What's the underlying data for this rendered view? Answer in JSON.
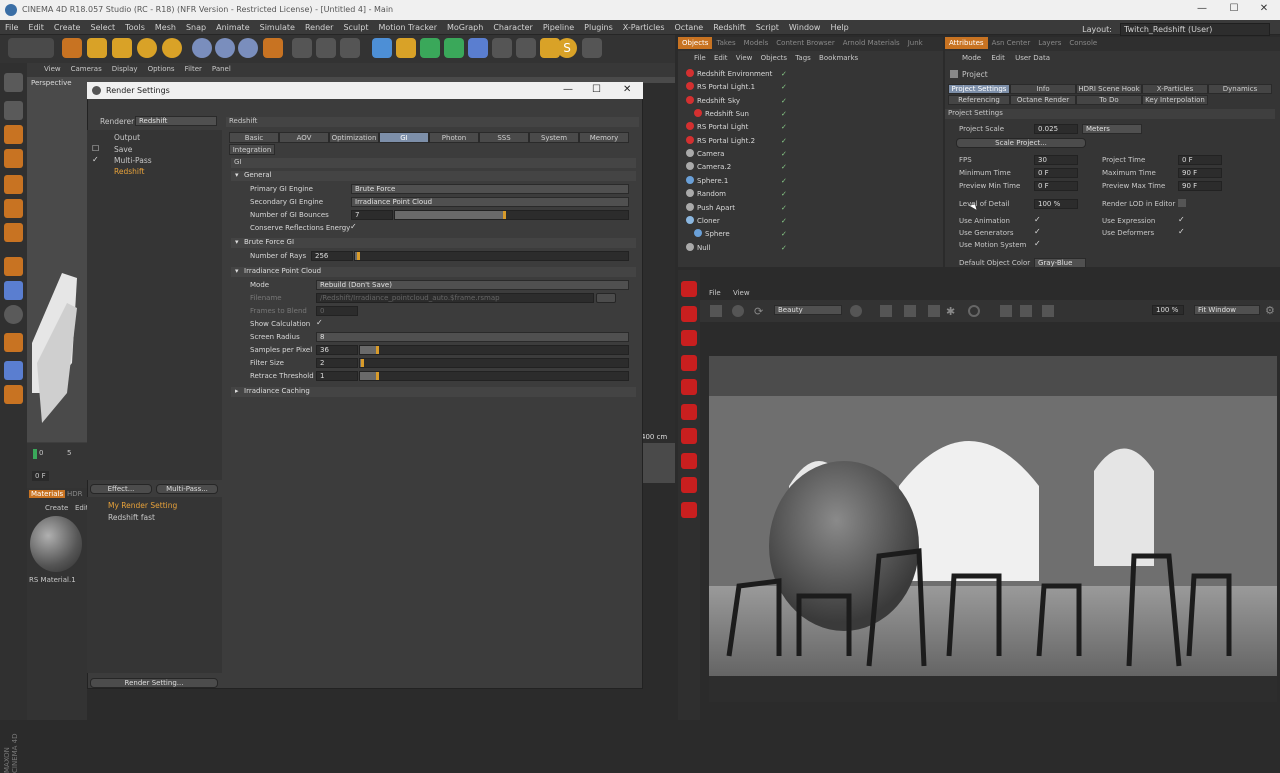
{
  "window": {
    "title": "CINEMA 4D R18.057 Studio (RC - R18) (NFR Version - Restricted License) - [Untitled 4] - Main"
  },
  "menu": [
    "File",
    "Edit",
    "Create",
    "Select",
    "Tools",
    "Mesh",
    "Snap",
    "Animate",
    "Simulate",
    "Render",
    "Sculpt",
    "Motion Tracker",
    "MoGraph",
    "Character",
    "Pipeline",
    "Plugins",
    "X-Particles",
    "Octane",
    "Redshift",
    "Script",
    "Window",
    "Help"
  ],
  "layout": {
    "label": "Layout:",
    "value": "Twitch_Redshift (User)"
  },
  "viewport": {
    "menu": [
      "View",
      "Cameras",
      "Display",
      "Options",
      "Filter",
      "Panel"
    ],
    "label": "Perspective",
    "scale": "400 cm"
  },
  "timeline": {
    "start": "0",
    "end": "5",
    "field": "0 F"
  },
  "materials": {
    "tabs": [
      "Materials",
      "HDR"
    ],
    "menu": [
      "Create",
      "Edit"
    ],
    "item": "RS Material.1"
  },
  "render_settings": {
    "title": "Render Settings",
    "renderer_label": "Renderer",
    "renderer_value": "Redshift",
    "tree": [
      "Output",
      "Save",
      "Multi-Pass",
      "Redshift"
    ],
    "presets": [
      "My Render Setting",
      "Redshift fast"
    ],
    "buttons": {
      "effect": "Effect...",
      "multipass": "Multi-Pass...",
      "render_setting": "Render Setting..."
    },
    "panel_header": "Redshift",
    "tabs": [
      "Basic",
      "AOV",
      "Optimization",
      "GI",
      "Photon",
      "SSS",
      "System",
      "Memory"
    ],
    "tab_integration": "Integration",
    "gi_label": "GI",
    "general": {
      "header": "General",
      "primary_label": "Primary GI Engine",
      "primary_value": "Brute Force",
      "secondary_label": "Secondary GI Engine",
      "secondary_value": "Irradiance Point Cloud",
      "bounces_label": "Number of GI Bounces",
      "bounces_value": "7",
      "conserve_label": "Conserve Reflections Energy"
    },
    "brute": {
      "header": "Brute Force GI",
      "rays_label": "Number of Rays",
      "rays_value": "256"
    },
    "ipc": {
      "header": "Irradiance Point Cloud",
      "mode_label": "Mode",
      "mode_value": "Rebuild (Don't Save)",
      "filename_label": "Filename",
      "filename_value": "/Redshift/Irradiance_pointcloud_auto.$frame.rsmap",
      "frames_label": "Frames to Blend",
      "frames_value": "0",
      "showcalc_label": "Show Calculation",
      "radius_label": "Screen Radius",
      "radius_value": "8",
      "spp_label": "Samples per Pixel",
      "spp_value": "36",
      "filter_label": "Filter Size",
      "filter_value": "2",
      "retrace_label": "Retrace Threshold",
      "retrace_value": "1"
    },
    "caching_header": "Irradiance Caching"
  },
  "objects": {
    "tabs": [
      "Objects",
      "Takes",
      "Models",
      "Content Browser",
      "Arnold Materials",
      "Junk"
    ],
    "menu": [
      "File",
      "Edit",
      "View",
      "Objects",
      "Tags",
      "Bookmarks"
    ],
    "items": [
      {
        "name": "Redshift Environment",
        "color": "#d43030"
      },
      {
        "name": "RS Portal Light.1",
        "color": "#d43030"
      },
      {
        "name": "Redshift Sky",
        "color": "#d43030"
      },
      {
        "name": "Redshift Sun",
        "color": "#d43030"
      },
      {
        "name": "RS Portal Light",
        "color": "#d43030"
      },
      {
        "name": "RS Portal Light.2",
        "color": "#d43030"
      },
      {
        "name": "Camera",
        "color": "#aaaaaa"
      },
      {
        "name": "Camera.2",
        "color": "#aaaaaa"
      },
      {
        "name": "Sphere.1",
        "color": "#6aa0d8"
      },
      {
        "name": "Random",
        "color": "#aaaaaa"
      },
      {
        "name": "Push Apart",
        "color": "#aaaaaa"
      },
      {
        "name": "Cloner",
        "color": "#8bb7e0"
      },
      {
        "name": "Sphere",
        "color": "#6aa0d8"
      },
      {
        "name": "Null",
        "color": "#aaaaaa"
      }
    ]
  },
  "attributes": {
    "tabs": [
      "Attributes",
      "Asn Center",
      "Layers",
      "Console"
    ],
    "menu": [
      "Mode",
      "Edit",
      "User Data"
    ],
    "title": "Project",
    "subtabs": [
      "Project Settings",
      "Info",
      "HDRI Scene Hook",
      "X-Particles",
      "Dynamics",
      "Referencing",
      "Octane Render",
      "To Do",
      "Key Interpolation"
    ],
    "section": "Project Settings",
    "scale_label": "Project Scale",
    "scale_value": "0.025",
    "scale_unit": "Meters",
    "scale_button": "Scale Project...",
    "fps_label": "FPS",
    "fps_value": "30",
    "project_time_label": "Project Time",
    "project_time_value": "0 F",
    "min_time_label": "Minimum Time",
    "min_time_value": "0 F",
    "max_time_label": "Maximum Time",
    "max_time_value": "90 F",
    "pmin_label": "Preview Min Time",
    "pmin_value": "0 F",
    "pmax_label": "Preview Max Time",
    "pmax_value": "90 F",
    "lod_label": "Level of Detail",
    "lod_value": "100 %",
    "render_lod_label": "Render LOD in Editor",
    "use_anim": "Use Animation",
    "use_expr": "Use Expression",
    "use_gen": "Use Generators",
    "use_def": "Use Deformers",
    "use_motion": "Use Motion System",
    "default_color_label": "Default Object Color",
    "default_color_value": "Gray-Blue"
  },
  "picture_viewer": {
    "menu": [
      "File",
      "View"
    ],
    "channel": "Beauty",
    "zoom": "100 %",
    "fit": "Fit Window"
  },
  "brand": "MAXON CINEMA 4D"
}
